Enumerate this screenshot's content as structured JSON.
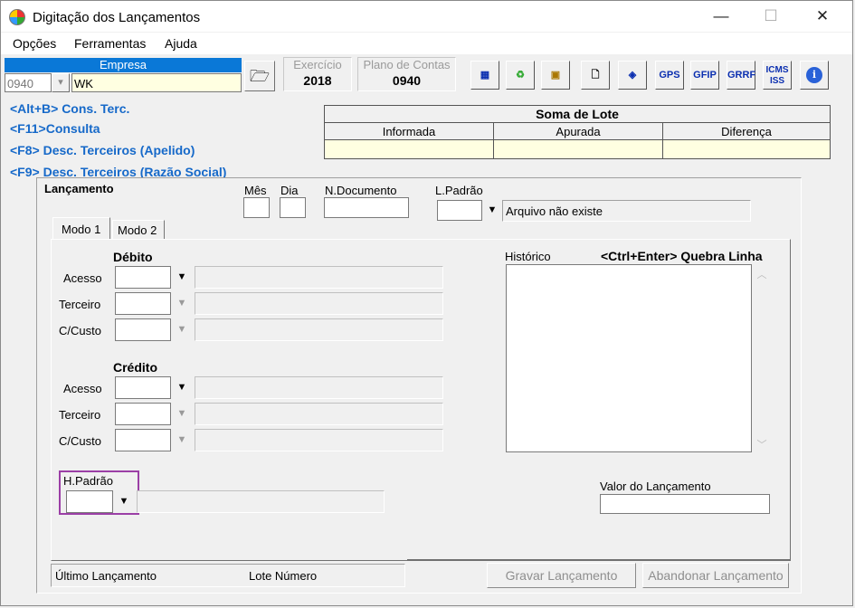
{
  "window": {
    "title": "Digitação dos Lançamentos",
    "minimize": "—",
    "maximize": "☐",
    "close": "✕"
  },
  "menu": {
    "items": [
      "Opções",
      "Ferramentas",
      "Ajuda"
    ]
  },
  "empresa": {
    "header": "Empresa",
    "code": "0940",
    "name": "WK",
    "open_icon": "folder-open-icon"
  },
  "exercicio": {
    "label": "Exercício",
    "value": "2018"
  },
  "plano": {
    "label": "Plano de Contas",
    "value": "0940"
  },
  "toolbar": {
    "buttons": [
      {
        "name": "calculator-icon",
        "text": ""
      },
      {
        "name": "recycle-bin-icon",
        "text": ""
      },
      {
        "name": "import-icon",
        "text": ""
      },
      {
        "name": "new-document-icon",
        "text": ""
      },
      {
        "name": "diamond-icon",
        "text": ""
      },
      {
        "name": "gps-button",
        "text": "GPS"
      },
      {
        "name": "gfip-button",
        "text": "GFIP"
      },
      {
        "name": "grrf-button",
        "text": "GRRF"
      },
      {
        "name": "icms-iss-button",
        "text": "ICMS ISS"
      },
      {
        "name": "info-icon",
        "text": "i"
      }
    ]
  },
  "shortcuts": [
    "<Alt+B> Cons. Terc.",
    "<F11>Consulta",
    "<F8> Desc. Terceiros (Apelido)",
    "<F9> Desc. Terceiros (Razão Social)"
  ],
  "soma": {
    "title": "Soma de Lote",
    "cols": [
      "Informada",
      "Apurada",
      "Diferença"
    ]
  },
  "lancamento": {
    "title": "Lançamento",
    "mes": "Mês",
    "dia": "Dia",
    "ndoc": "N.Documento",
    "lpadrao": "L.Padrão",
    "arquivo": "Arquivo não existe"
  },
  "tabs": [
    "Modo 1",
    "Modo 2"
  ],
  "debito": {
    "title": "Débito",
    "rows": [
      "Acesso",
      "Terceiro",
      "C/Custo"
    ]
  },
  "credito": {
    "title": "Crédito",
    "rows": [
      "Acesso",
      "Terceiro",
      "C/Custo"
    ]
  },
  "historico": {
    "label": "Histórico",
    "hint": "<Ctrl+Enter> Quebra Linha"
  },
  "hpadrao": {
    "label": "H.Padrão"
  },
  "valor": {
    "label": "Valor do Lançamento"
  },
  "status": {
    "ultimo": "Último Lançamento",
    "lote": "Lote Número"
  },
  "buttons": {
    "gravar": "Gravar Lançamento",
    "abandonar": "Abandonar Lançamento"
  },
  "colors": {
    "accent": "#0a78d7",
    "shortcut": "#1669c9",
    "highlight_box": "#9b3fa6",
    "yellow_field": "#ffffe1"
  }
}
